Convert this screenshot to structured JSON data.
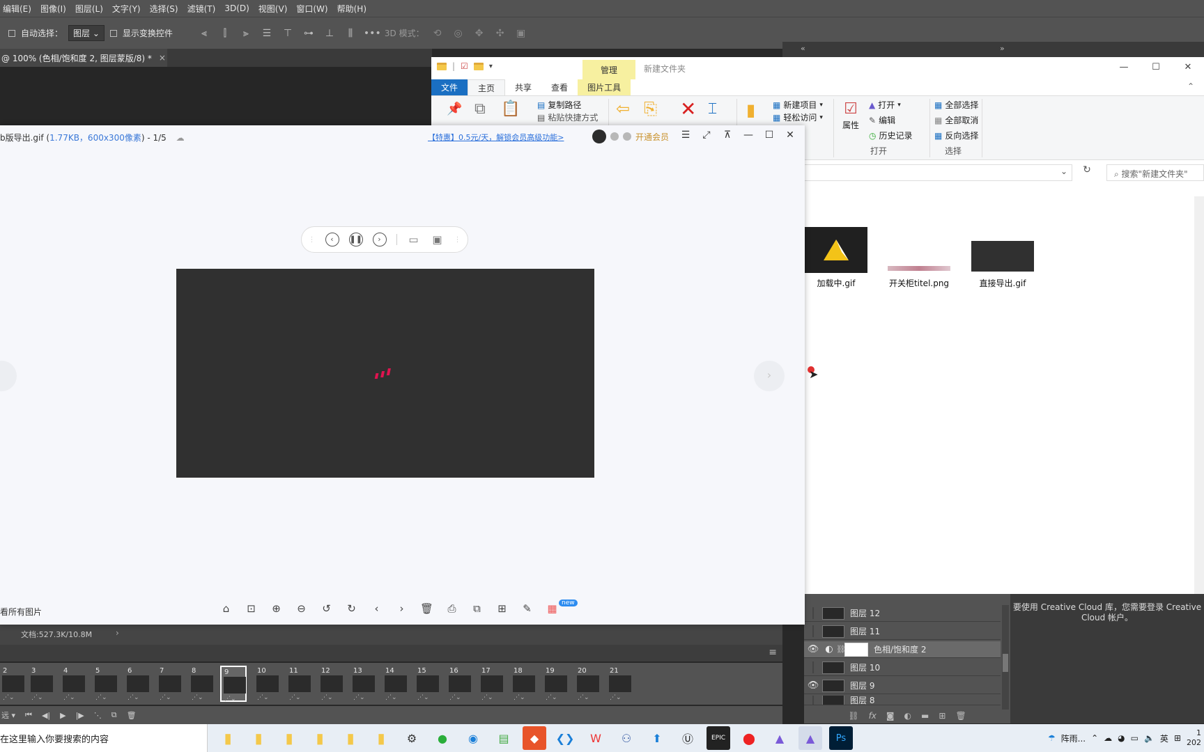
{
  "ps": {
    "menu": [
      "编辑(E)",
      "图像(I)",
      "图层(L)",
      "文字(Y)",
      "选择(S)",
      "滤镜(T)",
      "3D(D)",
      "视图(V)",
      "窗口(W)",
      "帮助(H)"
    ],
    "options": {
      "auto_select_label": "自动选择：",
      "auto_select_value": "图层",
      "show_transform_label": "显示变换控件",
      "mode_3d_label": "3D 模式："
    },
    "doc_tab": "@ 100% (色相/饱和度 2, 图层蒙版/8) *",
    "doc_tab_close": "×",
    "status_doc": "文档:527.3K/10.8M",
    "layers": [
      {
        "name": "图层 12",
        "visible": false
      },
      {
        "name": "图层 11",
        "visible": false
      },
      {
        "name": "色相/饱和度 2",
        "visible": true,
        "selected": true
      },
      {
        "name": "图层 10",
        "visible": false
      },
      {
        "name": "图层 9",
        "visible": true
      },
      {
        "name": "图层 8",
        "visible": false
      }
    ],
    "cc_message": "要使用 Creative Cloud 库，您需要登录 Creative Cloud 帐户。",
    "frames": [
      "2",
      "3",
      "4",
      "5",
      "6",
      "7",
      "8",
      "9",
      "10",
      "11",
      "12",
      "13",
      "14",
      "15",
      "16",
      "17",
      "18",
      "19",
      "20",
      "21"
    ],
    "selected_frame": "9",
    "loop_label": "远"
  },
  "explorer": {
    "manage_tab": "管理",
    "title": "新建文件夹",
    "tabs": [
      "文件",
      "主页",
      "共享",
      "查看",
      "图片工具"
    ],
    "ribbon": {
      "copy_path": "复制路径",
      "paste_shortcut": "粘贴快捷方式",
      "new_item": "新建项目",
      "easy_access": "轻松访问",
      "properties": "属性",
      "open": "打开",
      "edit": "编辑",
      "history": "历史记录",
      "group_open": "打开",
      "select_all": "全部选择",
      "select_none": "全部取消",
      "invert_selection": "反向选择",
      "group_select": "选择"
    },
    "search_placeholder": "搜索\"新建文件夹\"",
    "files": [
      "加载中.gif",
      "开关柜titel.png",
      "直接导出.gif"
    ]
  },
  "viewer": {
    "filename": "b版导出.gif",
    "meta": "1.77KB，600x300像素",
    "index": "- 1/5",
    "promo": "【特惠】0.5元/天，解锁会员高级功能>",
    "vip": "开通会员",
    "view_all": "看所有图片",
    "new_badge": "new"
  },
  "taskbar": {
    "search": "在这里输入你要搜索的内容",
    "weather": "阵雨...",
    "ime": "英",
    "time": "1",
    "date": "202"
  },
  "colors": {
    "ps_panel": "#535353",
    "ps_dark": "#282828",
    "explorer_file_tab": "#1a6fc2",
    "picture_tools": "#f7f0a0",
    "loader_red": "#e0134f",
    "vip_gold": "#c9922c",
    "promo_blue": "#2a6fdb"
  }
}
